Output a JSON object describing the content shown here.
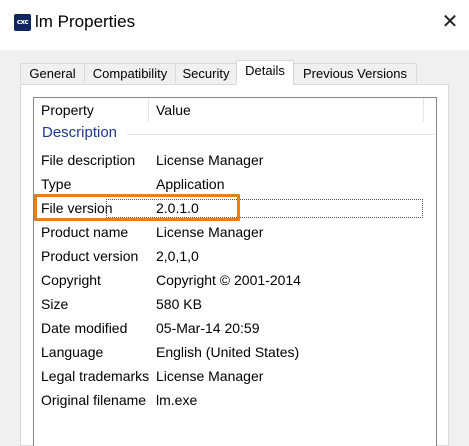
{
  "window": {
    "icon_text": "cxc",
    "title": "lm Properties",
    "close_glyph": "✕"
  },
  "tabs": [
    {
      "label": "General",
      "active": false
    },
    {
      "label": "Compatibility",
      "active": false
    },
    {
      "label": "Security",
      "active": false
    },
    {
      "label": "Details",
      "active": true
    },
    {
      "label": "Previous Versions",
      "active": false
    }
  ],
  "details": {
    "columns": {
      "property": "Property",
      "value": "Value"
    },
    "group": "Description",
    "rows": [
      {
        "property": "File description",
        "value": "License Manager"
      },
      {
        "property": "Type",
        "value": "Application"
      },
      {
        "property": "File version",
        "value": "2.0.1.0"
      },
      {
        "property": "Product name",
        "value": "License Manager"
      },
      {
        "property": "Product version",
        "value": "2,0,1,0"
      },
      {
        "property": "Copyright",
        "value": "Copyright © 2001-2014"
      },
      {
        "property": "Size",
        "value": "580 KB"
      },
      {
        "property": "Date modified",
        "value": "05-Mar-14 20:59"
      },
      {
        "property": "Language",
        "value": "English (United States)"
      },
      {
        "property": "Legal trademarks",
        "value": "License Manager"
      },
      {
        "property": "Original filename",
        "value": "lm.exe"
      }
    ]
  },
  "colors": {
    "highlight": "#e1801c",
    "group_text": "#1e3a8a",
    "icon_bg": "#12265e"
  }
}
